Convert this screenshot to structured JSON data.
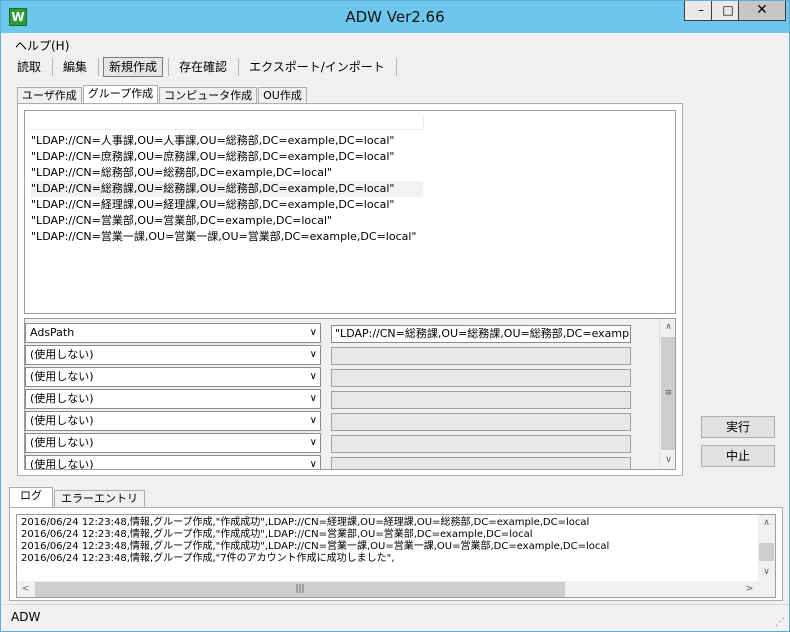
{
  "window": {
    "title": "ADW Ver2.66",
    "icon_name": "app-w-icon",
    "icon_letter": "W",
    "min_glyph": "–",
    "max_glyph": "□",
    "close_glyph": "✕"
  },
  "menu": {
    "help_label": "ヘルプ(H)"
  },
  "toolbar": {
    "items": [
      "読取",
      "編集",
      "新規作成",
      "存在確認",
      "エクスポート/インポート"
    ],
    "active_index": 2
  },
  "tabs": {
    "items": [
      "ユーザ作成",
      "グループ作成",
      "コンピュータ作成",
      "OU作成"
    ],
    "active_index": 1
  },
  "ldap_list": {
    "rows": [
      "\"LDAP://CN=人事課,OU=人事課,OU=総務部,DC=example,DC=local\"",
      "\"LDAP://CN=庶務課,OU=庶務課,OU=総務部,DC=example,DC=local\"",
      "\"LDAP://CN=総務部,OU=総務部,DC=example,DC=local\"",
      "\"LDAP://CN=総務課,OU=総務課,OU=総務部,DC=example,DC=local\"",
      "\"LDAP://CN=経理課,OU=経理課,OU=総務部,DC=example,DC=local\"",
      "\"LDAP://CN=営業部,OU=営業部,DC=example,DC=local\"",
      "\"LDAP://CN=営業一課,OU=営業一課,OU=営業部,DC=example,DC=local\""
    ],
    "selected_index": 3
  },
  "mapping": {
    "rows": [
      {
        "attribute": "AdsPath",
        "value": "\"LDAP://CN=総務課,OU=総務課,OU=総務部,DC=example,"
      },
      {
        "attribute": "(使用しない)",
        "value": ""
      },
      {
        "attribute": "(使用しない)",
        "value": ""
      },
      {
        "attribute": "(使用しない)",
        "value": ""
      },
      {
        "attribute": "(使用しない)",
        "value": ""
      },
      {
        "attribute": "(使用しない)",
        "value": ""
      },
      {
        "attribute": "(使用しない)",
        "value": ""
      }
    ],
    "combo_arrow": "∨",
    "scroll_up": "∧",
    "scroll_down": "∨",
    "thumb_grip": "≡"
  },
  "buttons": {
    "execute_label": "実行",
    "stop_label": "中止"
  },
  "log_tabs": {
    "items": [
      "ログ",
      "エラーエントリ"
    ],
    "active_index": 0
  },
  "log": {
    "lines": [
      "2016/06/24 12:23:48,情報,グループ作成,\"作成成功\",LDAP://CN=経理課,OU=経理課,OU=総務部,DC=example,DC=local",
      "2016/06/24 12:23:48,情報,グループ作成,\"作成成功\",LDAP://CN=営業部,OU=営業部,DC=example,DC=local",
      "2016/06/24 12:23:48,情報,グループ作成,\"作成成功\",LDAP://CN=営業一課,OU=営業一課,OU=営業部,DC=example,DC=local",
      "2016/06/24 12:23:48,情報,グループ作成,\"7件のアカウント作成に成功しました\","
    ],
    "hscroll_grip": "|||",
    "scroll_left": "<",
    "scroll_right": ">",
    "scroll_up": "∧",
    "scroll_down": "∨"
  },
  "status": {
    "text": "ADW",
    "grip": "⋰"
  }
}
